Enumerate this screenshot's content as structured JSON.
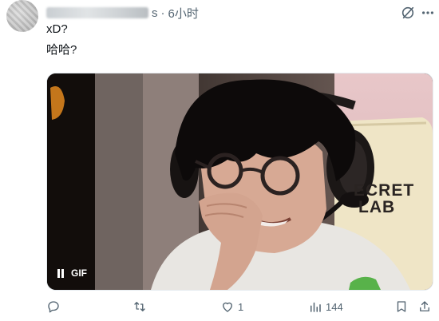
{
  "tweet": {
    "timestamp": "6小时",
    "separator": "·",
    "name_suffix": "s",
    "lines": [
      "xD?",
      "哈哈?"
    ]
  },
  "media": {
    "badge": "GIF",
    "overlay_text_line1": "ECRET",
    "overlay_text_line2": "LAB"
  },
  "actions": {
    "replies": "",
    "reposts": "",
    "likes": "1",
    "views": "144"
  },
  "icons": {
    "grok": "grok-icon",
    "more": "more-icon",
    "reply": "reply-icon",
    "repost": "repost-icon",
    "like": "heart-icon",
    "views": "views-icon",
    "bookmark": "bookmark-icon",
    "share": "share-icon"
  },
  "colors": {
    "muted": "#536471",
    "text": "#0f1419"
  }
}
